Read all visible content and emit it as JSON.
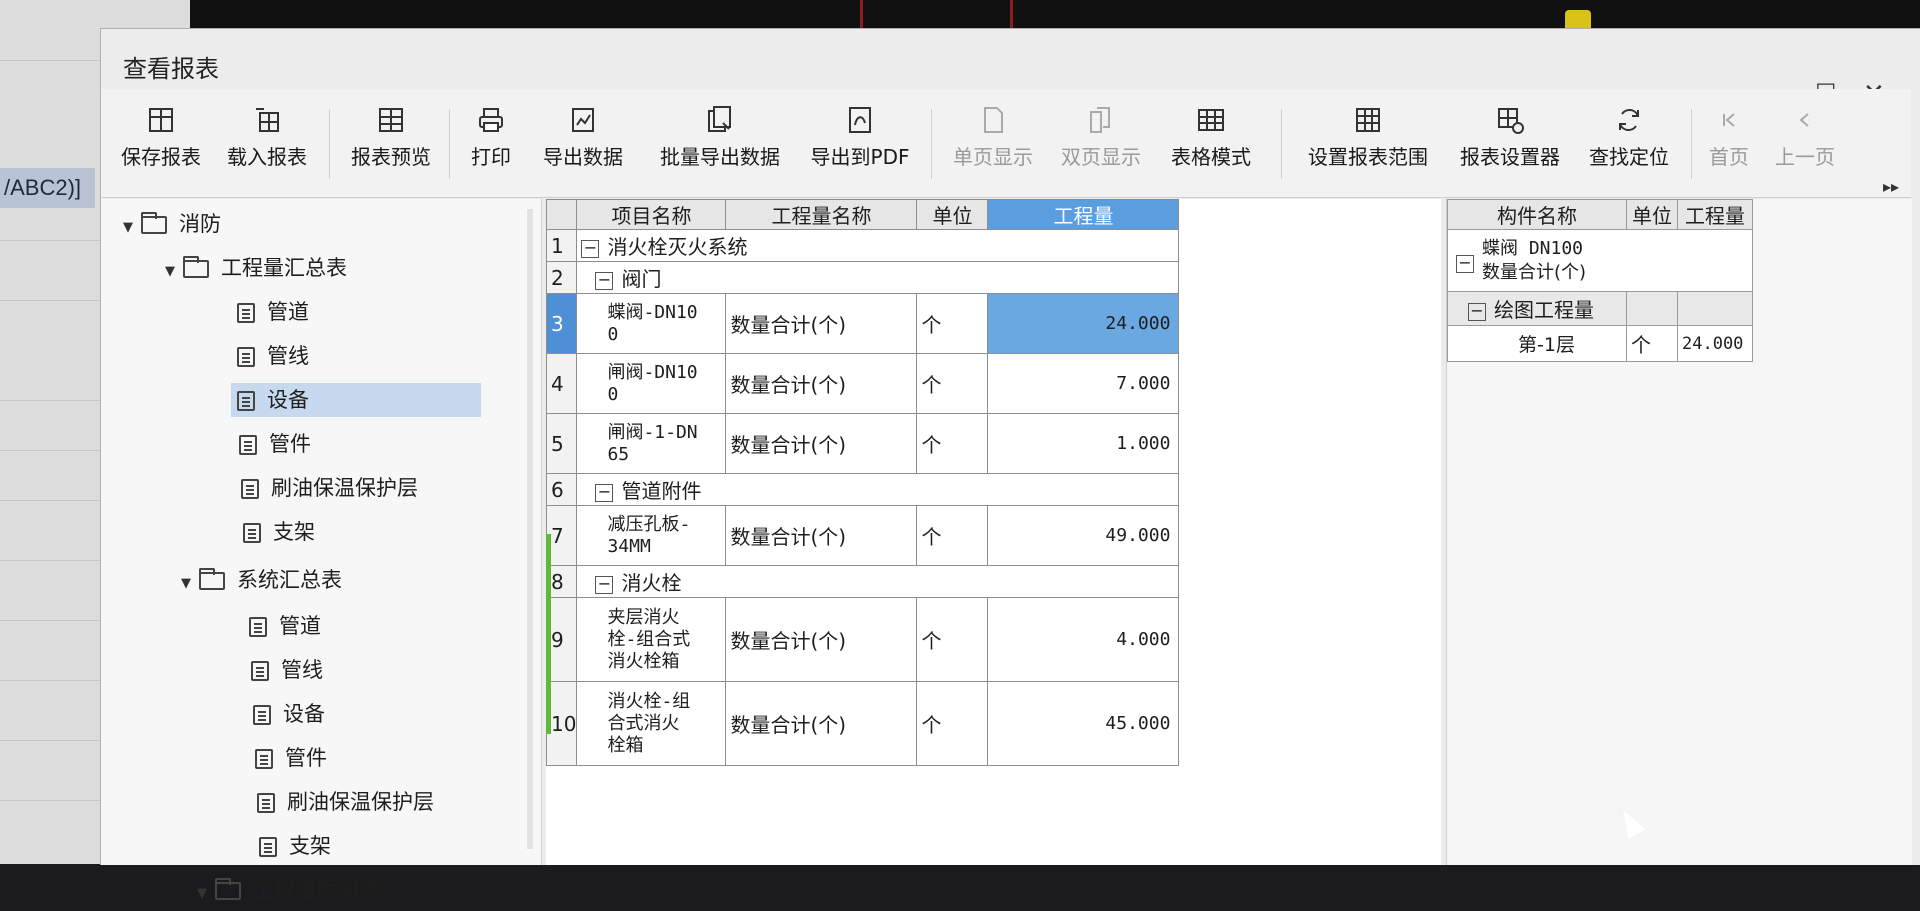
{
  "bg": {
    "left_tag": "/ABC2)]"
  },
  "window": {
    "title": "查看报表"
  },
  "toolbar": {
    "items": [
      {
        "label": "保存报表",
        "icon": "save-report-icon"
      },
      {
        "label": "载入报表",
        "icon": "load-report-icon"
      },
      {
        "label": "报表预览",
        "icon": "report-preview-icon"
      },
      {
        "label": "打印",
        "icon": "print-icon"
      },
      {
        "label": "导出数据",
        "icon": "export-data-icon"
      },
      {
        "label": "批量导出数据",
        "icon": "batch-export-icon"
      },
      {
        "label": "导出到PDF",
        "icon": "export-pdf-icon"
      },
      {
        "label": "单页显示",
        "icon": "single-page-icon",
        "disabled": true
      },
      {
        "label": "双页显示",
        "icon": "double-page-icon",
        "disabled": true
      },
      {
        "label": "表格模式",
        "icon": "table-mode-icon"
      },
      {
        "label": "设置报表范围",
        "icon": "report-range-icon"
      },
      {
        "label": "报表设置器",
        "icon": "report-settings-icon"
      },
      {
        "label": "查找定位",
        "icon": "find-locate-icon"
      },
      {
        "label": "首页",
        "icon": "first-page-icon",
        "disabled": true
      },
      {
        "label": "上一页",
        "icon": "prev-page-icon",
        "disabled": true
      }
    ]
  },
  "tree": {
    "root": "消防",
    "groups": [
      {
        "label": "工程量汇总表",
        "items": [
          "管道",
          "管线",
          "设备",
          "管件",
          "刷油保温保护层",
          "支架"
        ],
        "selected": "设备"
      },
      {
        "label": "系统汇总表",
        "items": [
          "管道",
          "管线",
          "设备",
          "管件",
          "刷油保温保护层",
          "支架"
        ]
      },
      {
        "label": "工程量明细表"
      }
    ]
  },
  "grid": {
    "headers": [
      "项目名称",
      "工程量名称",
      "单位",
      "工程量"
    ],
    "rows": [
      {
        "no": "1",
        "type": "group",
        "label": "消火栓灭火系统"
      },
      {
        "no": "2",
        "type": "group",
        "label": "阀门"
      },
      {
        "no": "3",
        "type": "item",
        "name_l1": "蝶阀-DN10",
        "name_l2": "0",
        "qty_name": "数量合计(个)",
        "unit": "个",
        "value": "24.000",
        "selected": true
      },
      {
        "no": "4",
        "type": "item",
        "name_l1": "闸阀-DN10",
        "name_l2": "0",
        "qty_name": "数量合计(个)",
        "unit": "个",
        "value": "7.000"
      },
      {
        "no": "5",
        "type": "item",
        "name_l1": "闸阀-1-DN",
        "name_l2": "65",
        "qty_name": "数量合计(个)",
        "unit": "个",
        "value": "1.000"
      },
      {
        "no": "6",
        "type": "group",
        "label": "管道附件"
      },
      {
        "no": "7",
        "type": "item",
        "name_l1": "减压孔板-",
        "name_l2": "34MM",
        "qty_name": "数量合计(个)",
        "unit": "个",
        "value": "49.000"
      },
      {
        "no": "8",
        "type": "group",
        "label": "消火栓"
      },
      {
        "no": "9",
        "type": "item",
        "name_l1": "夹层消火",
        "name_l2": "栓-组合式",
        "name_l3": "消火栓箱",
        "qty_name": "数量合计(个)",
        "unit": "个",
        "value": "4.000"
      },
      {
        "no": "10",
        "type": "item",
        "name_l1": "消火栓-组",
        "name_l2": "合式消火",
        "name_l3": "栓箱",
        "qty_name": "数量合计(个)",
        "unit": "个",
        "value": "45.000"
      }
    ]
  },
  "right": {
    "headers": [
      "构件名称",
      "单位",
      "工程量"
    ],
    "item_l1": "蝶阀 DN100",
    "item_l2": "数量合计(个)",
    "sub_group": "绘图工程量",
    "layer": "第-1层",
    "unit": "个",
    "value": "24.000"
  }
}
